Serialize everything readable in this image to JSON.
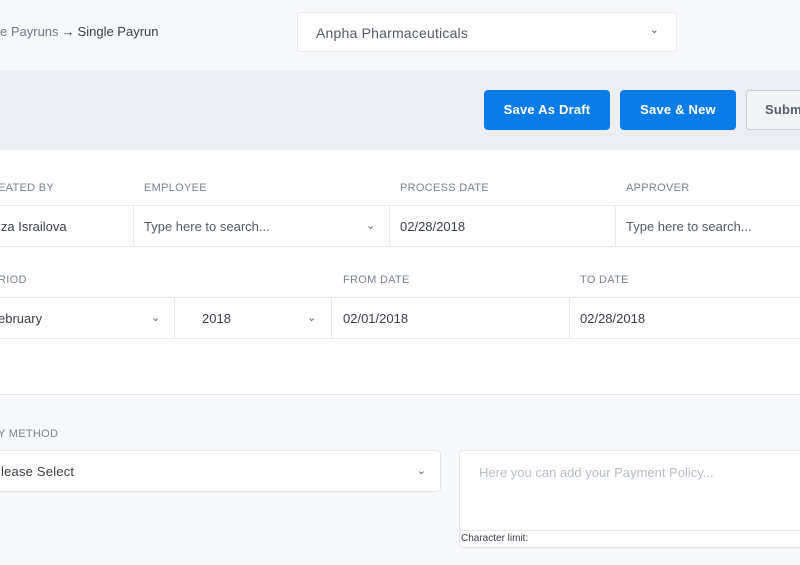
{
  "breadcrumb": {
    "parent": "e Payruns",
    "separator": "→",
    "current": "Single Payrun"
  },
  "company_select": {
    "value": "Anpha Pharmaceuticals"
  },
  "actions": {
    "save_draft": "Save As Draft",
    "save_new": "Save & New",
    "submit": "Subm"
  },
  "row1": {
    "created_by": {
      "label": "EATED BY",
      "value": "iza Israilova"
    },
    "employee": {
      "label": "EMPLOYEE",
      "placeholder": "Type here to search..."
    },
    "process_date": {
      "label": "PROCESS DATE",
      "value": "02/28/2018"
    },
    "approver": {
      "label": "APPROVER",
      "placeholder": "Type here to search..."
    }
  },
  "row2": {
    "period": {
      "label": "RIOD",
      "month": "ebruary",
      "year": "2018"
    },
    "from_date": {
      "label": "FROM DATE",
      "value": "02/01/2018"
    },
    "to_date": {
      "label": "TO DATE",
      "value": "02/28/2018"
    }
  },
  "payment": {
    "method_label": "Y METHOD",
    "method_value": "lease Select",
    "policy_placeholder": "Here you can add your Payment Policy...",
    "char_limit": "Character limit:"
  },
  "icons": {
    "chevron": "chevron-down-icon",
    "arrow": "arrow-right-icon"
  },
  "colors": {
    "primary": "#0a7ce8",
    "page_bg": "#f7f8fa",
    "action_bg": "#ebeef3"
  }
}
